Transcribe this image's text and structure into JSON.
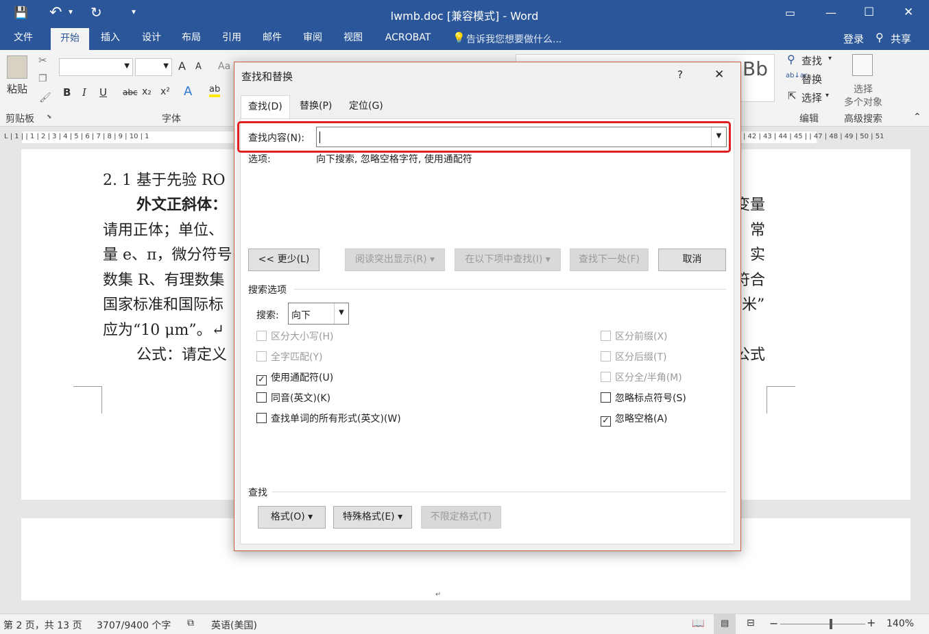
{
  "window": {
    "title": "lwmb.doc [兼容模式] - Word",
    "controls": {
      "restore_ribbon": "▭",
      "minimize": "—",
      "maximize": "☐",
      "close": "✕"
    }
  },
  "quick_access": {
    "save": "💾",
    "undo": "↶",
    "undo_dropdown": "▾",
    "redo": "↻",
    "customize": "▾"
  },
  "menu": {
    "tabs": [
      "文件",
      "开始",
      "插入",
      "设计",
      "布局",
      "引用",
      "邮件",
      "审阅",
      "视图",
      "ACROBAT"
    ],
    "tell_me": "告诉我您想要做什么...",
    "login": "登录",
    "share": "共享"
  },
  "ribbon": {
    "clipboard": {
      "paste": "粘贴",
      "label": "剪贴板"
    },
    "font": {
      "label": "字体",
      "grow": "A",
      "shrink": "A",
      "clear": "Aa",
      "bold": "B",
      "italic": "I",
      "underline": "U",
      "strike": "abc",
      "sub": "x₂",
      "sup": "x²",
      "effects": "A",
      "highlight": "ab"
    },
    "styles": {
      "preview": "Bb"
    },
    "editing": {
      "label": "编辑",
      "find": "查找",
      "replace": "替换",
      "select": "选择"
    },
    "advanced": {
      "label": "高级搜索",
      "select_objects_1": "选择",
      "select_objects_2": "多个对象"
    }
  },
  "ruler": {
    "left_text": "L  | 1 |    | 1 | 2 | 3 | 4 | 5 | 6 | 7 | 8 | 9 | 10 | 1",
    "right_text": "| 42 | 43 | 44 | 45 |    | 47 | 48 | 49 | 50 | 51"
  },
  "document": {
    "lines_left": [
      "2. 1   基于先验 RO",
      "外文正斜体：",
      "请用正体；单位、",
      "量 e、π，微分符号",
      "数集 R、有理数集",
      "国家标准和国际标",
      "应为“10 μm”。↵",
      "公式：请定义"
    ],
    "lines_right": [
      "变量",
      "常",
      "实",
      "符合",
      "米”",
      "公式"
    ],
    "page_end_mark": "↵"
  },
  "dialog": {
    "title": "查找和替换",
    "help": "?",
    "close": "✕",
    "tabs": [
      "查找(D)",
      "替换(P)",
      "定位(G)"
    ],
    "find_label": "查找内容(N):",
    "find_value": "",
    "options_label": "选项:",
    "options_value": "向下搜索, 忽略空格字符, 使用通配符",
    "buttons": {
      "less": "<< 更少(L)",
      "reading_highlight": "阅读突出显示(R) ▾",
      "find_in": "在以下项中查找(I) ▾",
      "find_next": "查找下一处(F)",
      "cancel": "取消"
    },
    "search_options_title": "搜索选项",
    "search_label": "搜索:",
    "search_direction": "向下",
    "checkboxes_left": [
      {
        "label": "区分大小写(H)",
        "checked": false,
        "enabled": false
      },
      {
        "label": "全字匹配(Y)",
        "checked": false,
        "enabled": false
      },
      {
        "label": "使用通配符(U)",
        "checked": true,
        "enabled": true
      },
      {
        "label": "同音(英文)(K)",
        "checked": false,
        "enabled": true
      },
      {
        "label": "查找单词的所有形式(英文)(W)",
        "checked": false,
        "enabled": true
      }
    ],
    "checkboxes_right": [
      {
        "label": "区分前缀(X)",
        "checked": false,
        "enabled": false
      },
      {
        "label": "区分后缀(T)",
        "checked": false,
        "enabled": false
      },
      {
        "label": "区分全/半角(M)",
        "checked": false,
        "enabled": false
      },
      {
        "label": "忽略标点符号(S)",
        "checked": false,
        "enabled": true
      },
      {
        "label": "忽略空格(A)",
        "checked": true,
        "enabled": true
      }
    ],
    "find_section_title": "查找",
    "format_buttons": {
      "format": "格式(O) ▾",
      "special": "特殊格式(E) ▾",
      "no_format": "不限定格式(T)"
    }
  },
  "status": {
    "page": "第 2 页，共 13 页",
    "words": "3707/9400 个字",
    "language": "英语(美国)",
    "zoom_minus": "−",
    "zoom_plus": "+",
    "zoom": "140%",
    "zoom_level_fraction": 0.6
  },
  "colors": {
    "accent": "#2b579a",
    "highlight_border": "#e02020",
    "dialog_border": "#c85a3f"
  }
}
